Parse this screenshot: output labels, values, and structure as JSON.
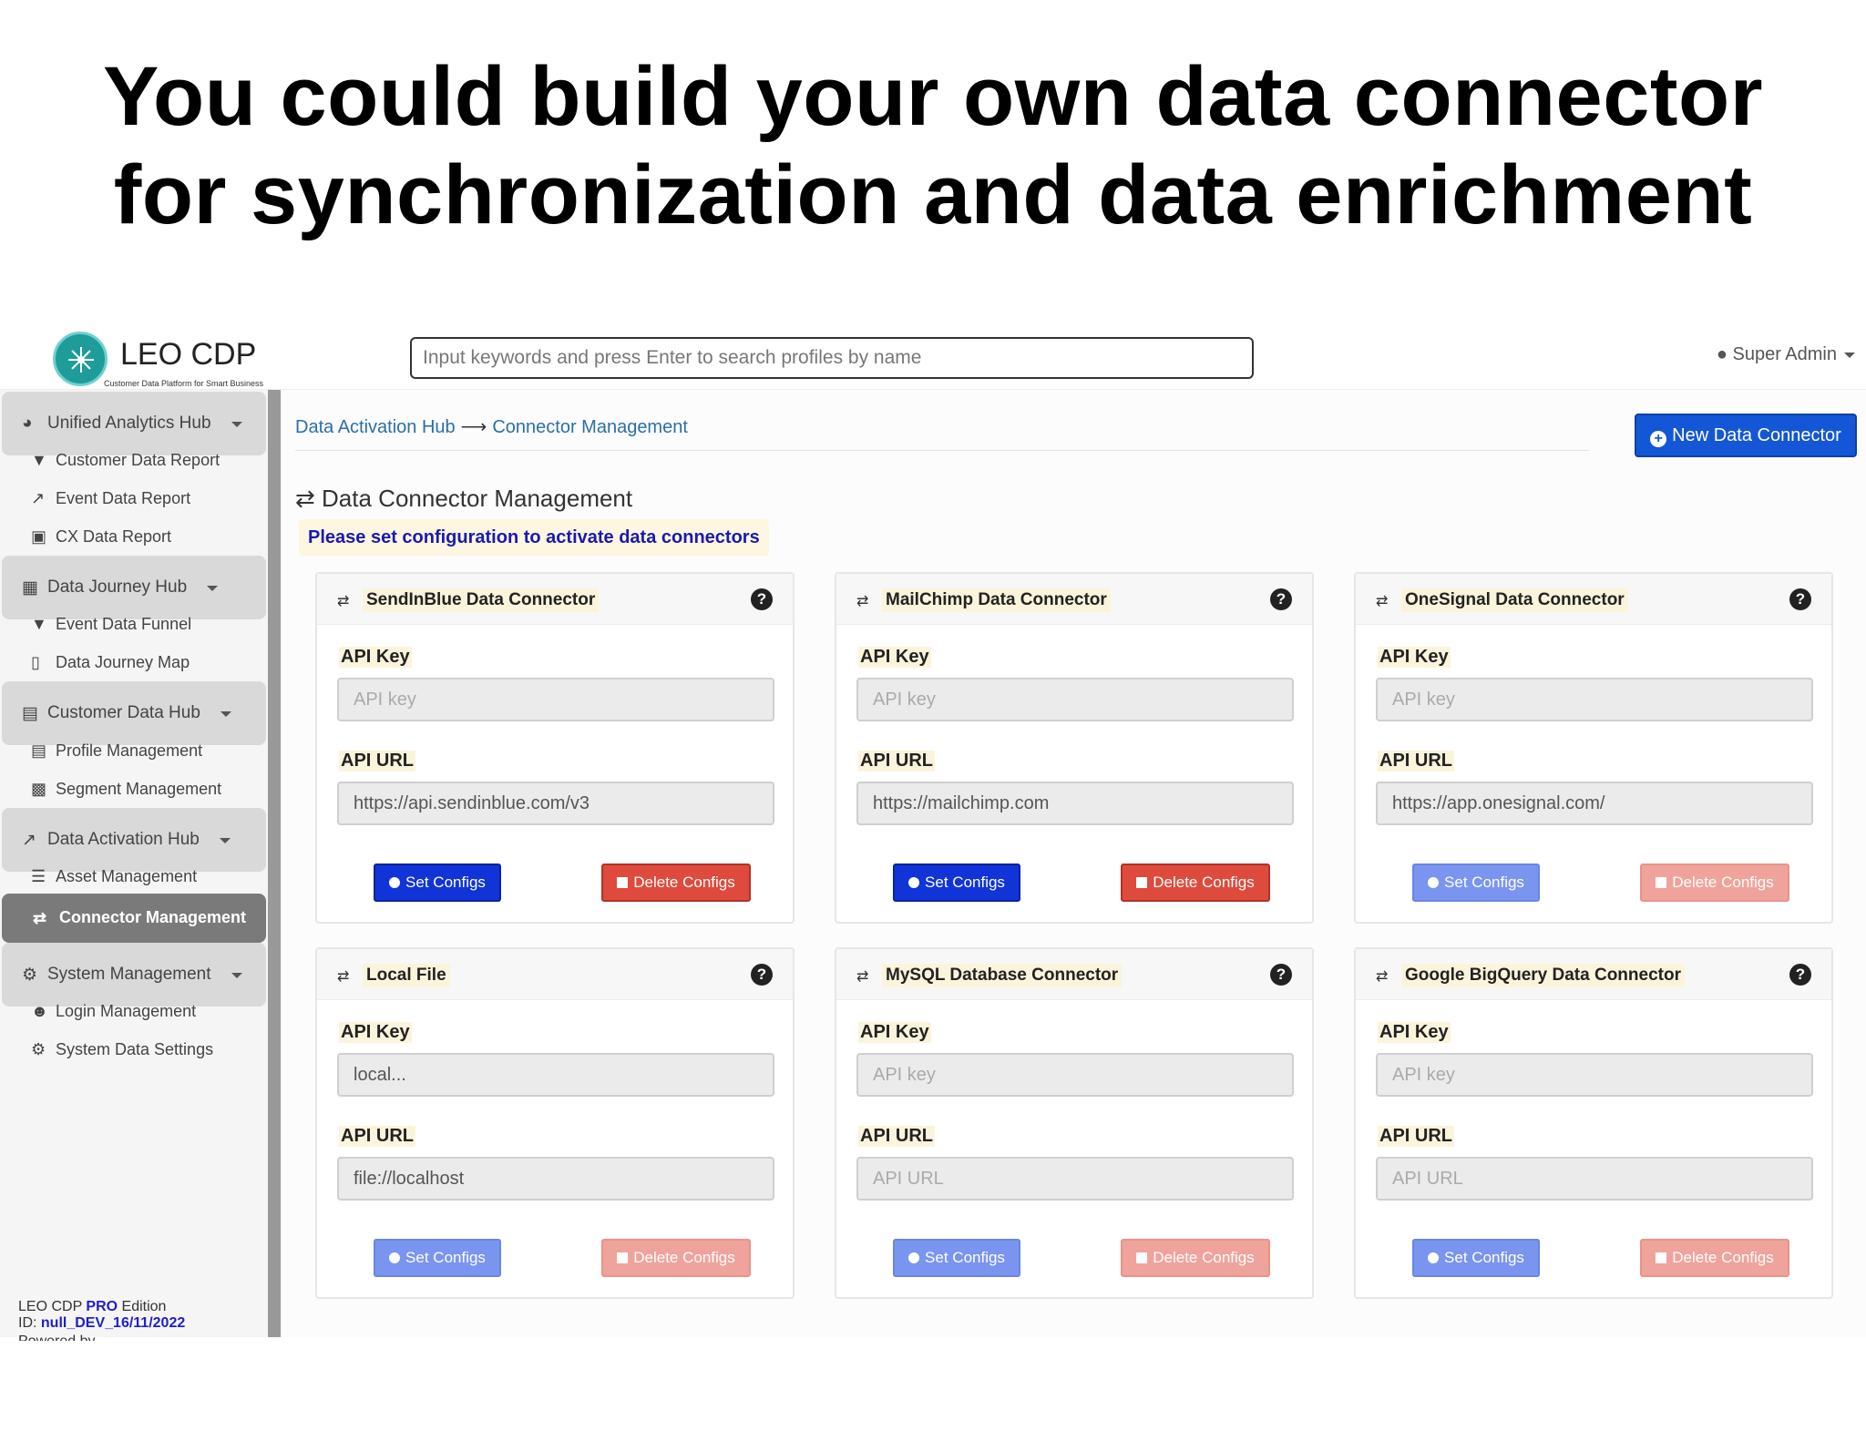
{
  "headline": {
    "line1": "You could build your own data connector",
    "line2": "for synchronization and data enrichment"
  },
  "topbar": {
    "logo_text": "LEO CDP",
    "logo_sub": "Customer Data Platform for Smart Business",
    "search_placeholder": "Input keywords and press Enter to search profiles by name",
    "user_label": "Super Admin"
  },
  "sidebar": {
    "items": [
      {
        "type": "hub",
        "label": "Unified Analytics Hub",
        "icon": "pie-chart-icon"
      },
      {
        "type": "sub",
        "label": "Customer Data Report",
        "icon": "filter-icon"
      },
      {
        "type": "sub",
        "label": "Event Data Report",
        "icon": "line-chart-icon"
      },
      {
        "type": "sub",
        "label": "CX Data Report",
        "icon": "gamepad-icon"
      },
      {
        "type": "hub",
        "label": "Data Journey Hub",
        "icon": "map-icon"
      },
      {
        "type": "sub",
        "label": "Event Data Funnel",
        "icon": "filter-icon"
      },
      {
        "type": "sub",
        "label": "Data Journey Map",
        "icon": "map-outline-icon"
      },
      {
        "type": "hub",
        "label": "Customer Data Hub",
        "icon": "id-card-icon"
      },
      {
        "type": "sub",
        "label": "Profile Management",
        "icon": "id-card-icon"
      },
      {
        "type": "sub",
        "label": "Segment Management",
        "icon": "object-group-icon"
      },
      {
        "type": "hub",
        "label": "Data Activation Hub",
        "icon": "line-chart-icon"
      },
      {
        "type": "sub",
        "label": "Asset Management",
        "icon": "list-icon"
      },
      {
        "type": "sub",
        "label": "Connector Management",
        "icon": "exchange-icon",
        "active": true
      },
      {
        "type": "hub",
        "label": "System Management",
        "icon": "cogs-icon"
      },
      {
        "type": "sub",
        "label": "Login Management",
        "icon": "user-plus-icon"
      },
      {
        "type": "sub",
        "label": "System Data Settings",
        "icon": "gear-icon"
      }
    ],
    "edition_prefix": "LEO CDP",
    "edition_pro": "PRO",
    "edition_suffix": "Edition",
    "id_label": "ID:",
    "id_value": "null_DEV_16/11/2022",
    "powered_by": "Powered by"
  },
  "main": {
    "breadcrumb": {
      "parent": "Data Activation Hub",
      "current": "Connector Management"
    },
    "new_button": "New Data Connector",
    "title": "Data Connector Management",
    "notice": "Please set configuration to activate data connectors",
    "api_key_label": "API Key",
    "api_url_label": "API URL",
    "set_label": "Set Configs",
    "delete_label": "Delete Configs",
    "connectors": [
      {
        "title": "SendInBlue Data Connector",
        "api_key_value": "",
        "api_key_placeholder": "API key",
        "api_url_value": "https://api.sendinblue.com/v3",
        "api_url_placeholder": "API URL",
        "active": true
      },
      {
        "title": "MailChimp Data Connector",
        "api_key_value": "",
        "api_key_placeholder": "API key",
        "api_url_value": "https://mailchimp.com",
        "api_url_placeholder": "API URL",
        "active": true
      },
      {
        "title": "OneSignal Data Connector",
        "api_key_value": "",
        "api_key_placeholder": "API key",
        "api_url_value": "https://app.onesignal.com/",
        "api_url_placeholder": "API URL",
        "active": false
      },
      {
        "title": "Local File",
        "api_key_value": "local...",
        "api_key_placeholder": "API key",
        "api_url_value": "file://localhost",
        "api_url_placeholder": "API URL",
        "active": false
      },
      {
        "title": "MySQL Database Connector",
        "api_key_value": "",
        "api_key_placeholder": "API key",
        "api_url_value": "",
        "api_url_placeholder": "API URL",
        "active": false
      },
      {
        "title": "Google BigQuery Data Connector",
        "api_key_value": "",
        "api_key_placeholder": "API key",
        "api_url_value": "",
        "api_url_placeholder": "API URL",
        "active": false
      }
    ]
  },
  "colors": {
    "primary_button": "#1034d8",
    "danger_button": "#de4a3c",
    "link": "#2a6fa8",
    "notice_text": "#1a1ab0",
    "logo": "#1e9c9a"
  }
}
